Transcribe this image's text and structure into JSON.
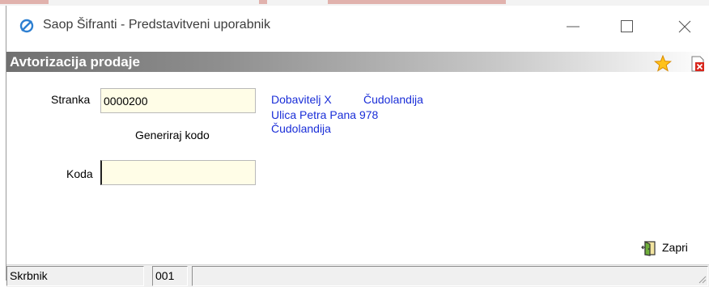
{
  "window": {
    "title": "Saop Šifranti - Predstavitveni uporabnik",
    "buttons": [
      "minimize",
      "maximize",
      "close"
    ]
  },
  "form": {
    "title": "Avtorizacija prodaje",
    "stranka_label": "Stranka",
    "stranka_value": "0000200",
    "generate_label": "Generiraj kodo",
    "koda_label": "Koda",
    "koda_value": ""
  },
  "customer": {
    "name": "Dobavitelj X",
    "place": "Čudolandija",
    "street": "Ulica Petra Pana 978",
    "city": "Čudolandija"
  },
  "actions": {
    "close_label": "Zapri"
  },
  "status": {
    "user": "Skrbnik",
    "code": "001",
    "extra": ""
  },
  "icons": [
    "app-logo-icon",
    "favorite-star-icon",
    "close-document-icon",
    "exit-door-icon",
    "resize-grip-icon"
  ],
  "colors": {
    "link_blue": "#1a2ed8",
    "field_bg": "#fffde7",
    "header_gray": "#7a7a7a"
  }
}
